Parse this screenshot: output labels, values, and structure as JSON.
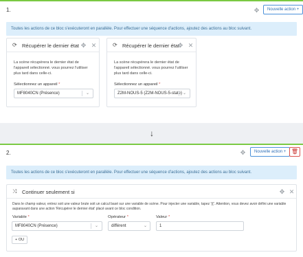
{
  "blocks": [
    {
      "number": "1.",
      "add_action_label": "Nouvelle action +",
      "info": "Toutes les actions de ce bloc s'exécuteront en parallèle. Pour effectuer une séquence d'actions, ajoutez des actions au bloc suivant.",
      "cards": [
        {
          "title": "Récupérer le dernier état",
          "description_line1": "La scène récupérera le dernier état de",
          "description_line2": "l'appareil sélectionné. vous pourrez l'utiliser",
          "description_line3": "plus tard dans celle-ci.",
          "field_label": "Sélectionnez un appareil",
          "required_mark": "*",
          "selected_device": "MF8040CN (Présence)"
        },
        {
          "title": "Récupérer le dernier état",
          "description_line1": "La scène récupérera le dernier état de",
          "description_line2": "l'appareil sélectionné. vous pourrez l'utiliser",
          "description_line3": "plus tard dans celle-ci.",
          "field_label": "Sélectionnez un appareil",
          "required_mark": "*",
          "selected_device": "Z2M-NOUS-5 (Z2M-NOUS-5-state)"
        }
      ]
    },
    {
      "number": "2.",
      "add_action_label": "Nouvelle action +",
      "info": "Toutes les actions de ce bloc s'exécuteront en parallèle. Pour effectuer une séquence d'actions, ajoutez des actions au bloc suivant.",
      "condition": {
        "title": "Continuer seulement si",
        "description_line1": "Dans le champ valeur, entrez soit une valeur brute soit un calcul basé sur une variable de scène. Pour injecter une variable, tapez '{{'. Attention, vous devez avoir défini une variable",
        "description_line2": "auparavant dans une action 'Récupérer le dernier état' placé avant ce bloc condition.",
        "variable_label": "Variable",
        "variable_value": "MF8040CN (Présence)",
        "operator_label": "Opérateur",
        "operator_value": "différent",
        "value_label": "Valeur",
        "value_value": "1",
        "required_mark": "*",
        "or_button": "+ OU"
      }
    }
  ],
  "icons": {
    "move": "move-icon",
    "close": "close-icon",
    "refresh": "refresh-icon",
    "shuffle": "shuffle-icon",
    "trash": "trash-icon",
    "arrow_down": "arrow-down-icon",
    "chevron_down": "chevron-down-icon"
  },
  "colors": {
    "block_border": "#7ac943",
    "info_bg": "#dceefb",
    "primary": "#4a90d9",
    "danger": "#d9534f"
  }
}
